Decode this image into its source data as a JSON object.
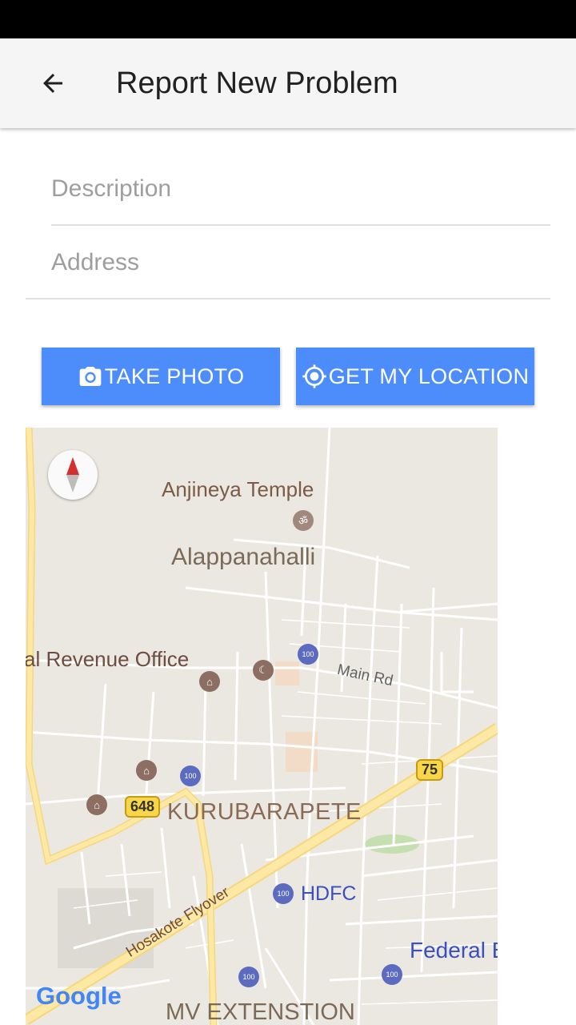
{
  "app_bar": {
    "title": "Report New Problem"
  },
  "form": {
    "description_placeholder": "Description",
    "address_placeholder": "Address"
  },
  "buttons": {
    "take_photo": "TAKE PHOTO",
    "get_location": "GET MY LOCATION"
  },
  "map": {
    "labels": {
      "anjineya": "Anjineya Temple",
      "alappanahalli": "Alappanahalli",
      "revenue": "al Revenue Office",
      "main_rd": "Main Rd",
      "kurubarapete": "KURUBARAPETE",
      "hdfc": "HDFC",
      "flyover": "Hosakote Flyover",
      "federal": "Federal B",
      "mv_ext": "MV EXTENSTION",
      "route_75": "75",
      "route_648": "648",
      "atm_text": "100",
      "google": "Google"
    }
  },
  "colors": {
    "accent": "#4c8dfb",
    "map_bg": "#ebe8e1",
    "highway": "#fbe39f",
    "label_brown": "#7b5b47",
    "bank_blue": "#3b4fbf"
  }
}
